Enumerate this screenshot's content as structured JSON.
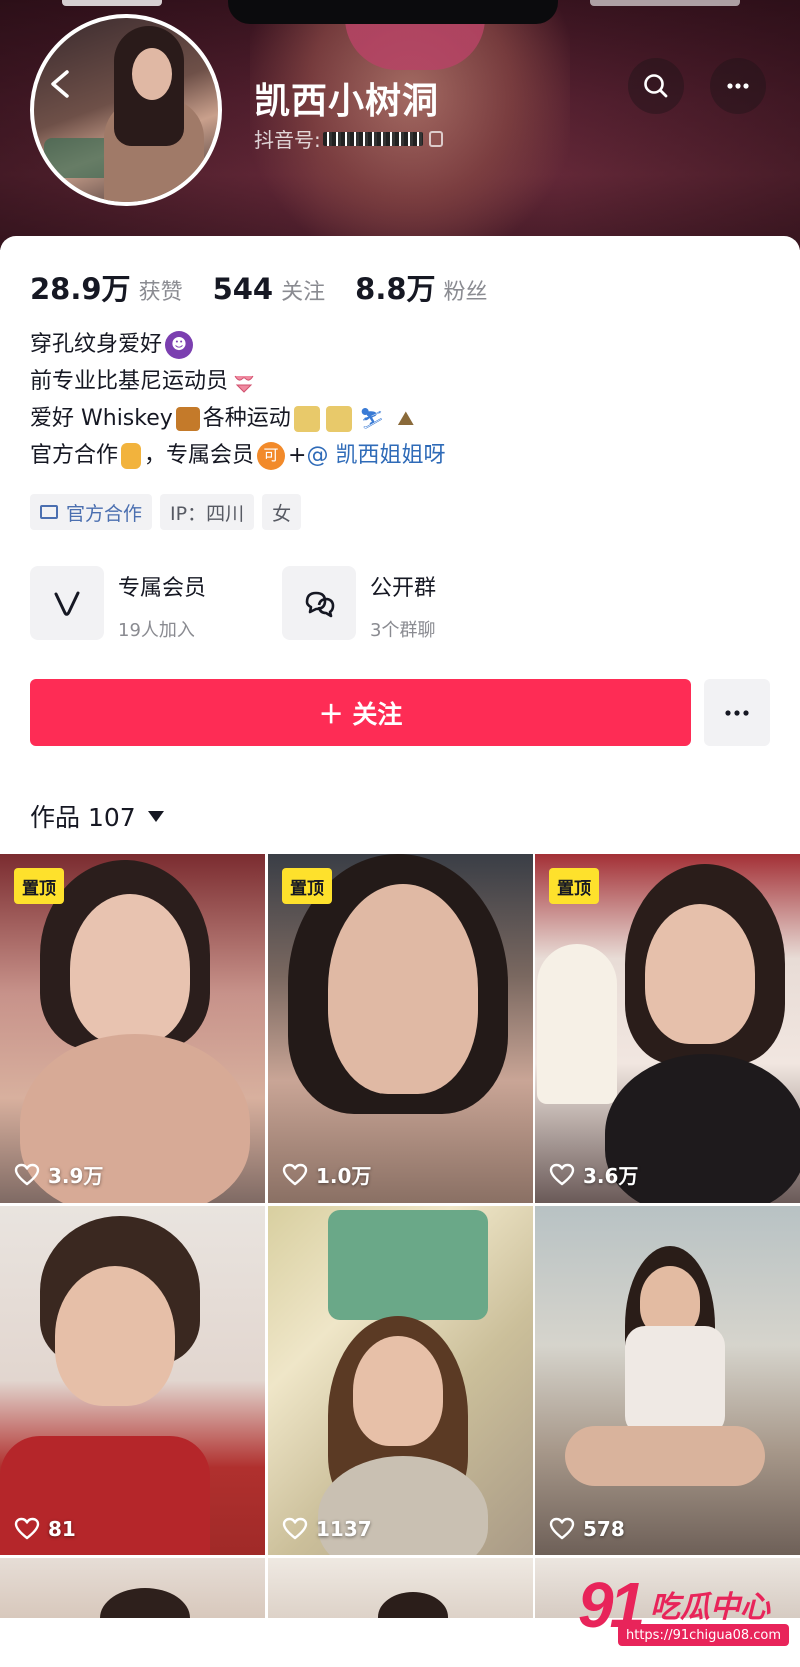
{
  "profile": {
    "nickname": "凯西小树洞",
    "douyin_id_label": "抖音号:"
  },
  "stats": [
    {
      "num": "28.9万",
      "label": "获赞"
    },
    {
      "num": "544",
      "label": "关注"
    },
    {
      "num": "8.8万",
      "label": "粉丝"
    }
  ],
  "bio": {
    "line1": "穿孔纹身爱好",
    "line2": "前专业比基尼运动员",
    "line3_a": "爱好 Whiskey",
    "line3_b": "各种运动",
    "line4_a": "官方合作",
    "line4_b": "，专属会员",
    "line4_c": "+",
    "line4_mention": "@ 凯西姐姐呀",
    "member_icon_text": "可"
  },
  "tags": {
    "official": "官方合作",
    "ip": "IP：四川",
    "gender": "女"
  },
  "features": {
    "member": {
      "title": "专属会员",
      "sub": "19人加入"
    },
    "group": {
      "title": "公开群",
      "sub": "3个群聊"
    }
  },
  "actions": {
    "follow": "＋ 关注"
  },
  "works": {
    "label": "作品 107"
  },
  "grid": [
    {
      "pinned": true,
      "pin_label": "置顶",
      "likes": "3.9万"
    },
    {
      "pinned": true,
      "pin_label": "置顶",
      "likes": "1.0万"
    },
    {
      "pinned": true,
      "pin_label": "置顶",
      "likes": "3.6万"
    },
    {
      "pinned": false,
      "likes": "81"
    },
    {
      "pinned": false,
      "likes": "1137"
    },
    {
      "pinned": false,
      "likes": "578"
    }
  ],
  "watermark": {
    "brand_num": "91",
    "brand_cn": "吃瓜中心",
    "url": "https://91chigua08.com"
  },
  "colors": {
    "accent": "#fe2c55",
    "pin": "#fee12c",
    "mention": "#2f6bb8"
  }
}
